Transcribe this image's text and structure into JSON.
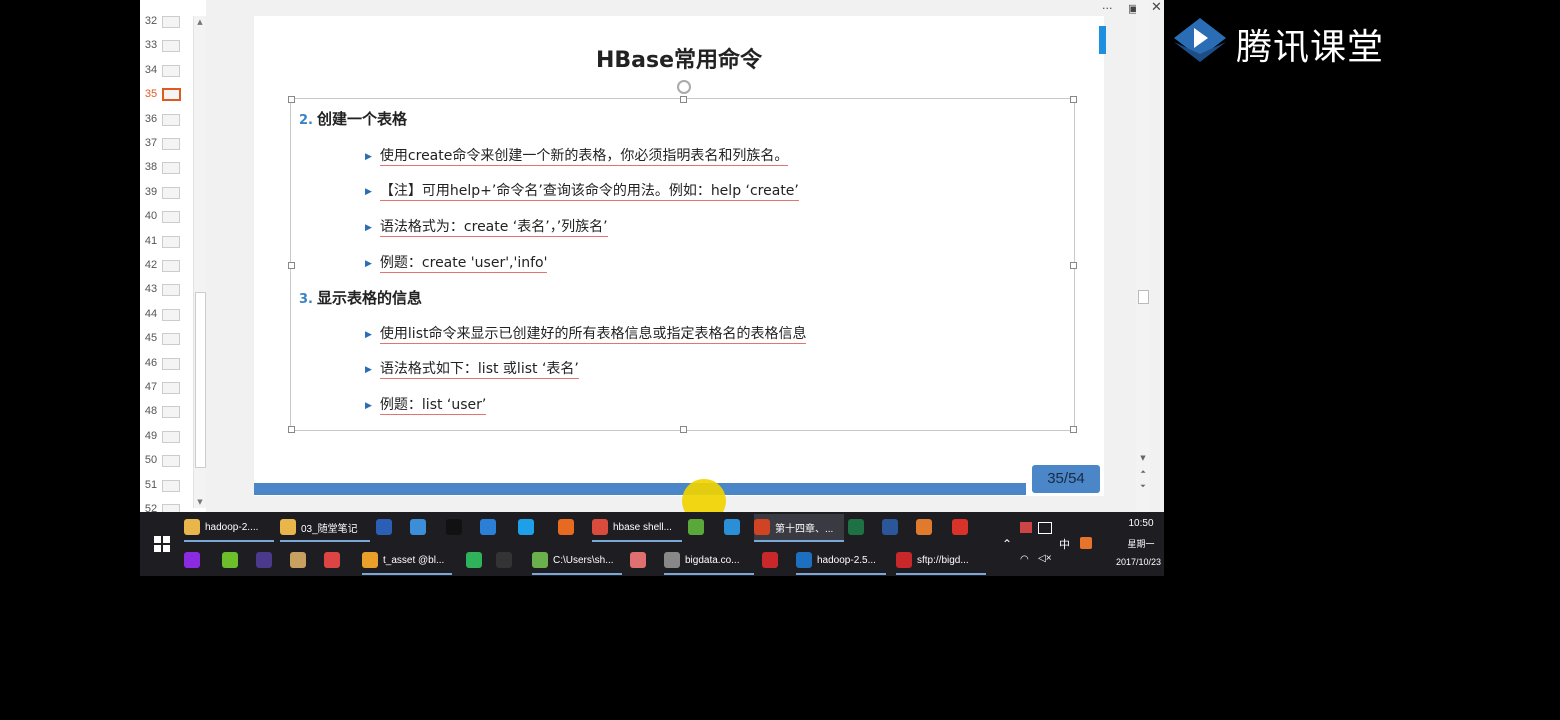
{
  "thumbnails": {
    "items": [
      {
        "number": "32"
      },
      {
        "number": "33"
      },
      {
        "number": "34"
      },
      {
        "number": "35"
      },
      {
        "number": "36"
      },
      {
        "number": "37"
      },
      {
        "number": "38"
      },
      {
        "number": "39"
      },
      {
        "number": "40"
      },
      {
        "number": "41"
      },
      {
        "number": "42"
      },
      {
        "number": "43"
      },
      {
        "number": "44"
      },
      {
        "number": "45"
      },
      {
        "number": "46"
      },
      {
        "number": "47"
      },
      {
        "number": "48"
      },
      {
        "number": "49"
      },
      {
        "number": "50"
      },
      {
        "number": "51"
      },
      {
        "number": "52"
      }
    ],
    "active": "35"
  },
  "slide": {
    "title": "HBase常用命令",
    "section1": {
      "number": "2.",
      "heading": "创建一个表格"
    },
    "section1_bullets": [
      "使用create命令来创建一个新的表格，你必须指明表名和列族名。",
      "【注】可用help+’命令名’查询该命令的用法。例如：help ‘create’",
      "语法格式为：create ‘表名’，’列族名’",
      "例题：create 'user','info'"
    ],
    "section2": {
      "number": "3.",
      "heading": "显示表格的信息"
    },
    "section2_bullets": [
      "使用list命令来显示已创建好的所有表格信息或指定表格名的表格信息",
      "语法格式如下：list 或list ‘表名’",
      "例题：list ‘user’"
    ],
    "page_indicator": "35/54",
    "progress": 0.648,
    "accent_color": "#4a86c8"
  },
  "taskbar": {
    "row1": [
      {
        "label": "hadoop-2....",
        "icon": "folder-icon",
        "color": "#e8b64a"
      },
      {
        "label": "03_随堂笔记",
        "icon": "folder-icon",
        "color": "#e8b64a"
      },
      {
        "label": "",
        "icon": "g-app-icon",
        "color": "#2b5fb5"
      },
      {
        "label": "",
        "icon": "network-icon",
        "color": "#3c8ed8"
      },
      {
        "label": "",
        "icon": "qq-icon",
        "color": "#111"
      },
      {
        "label": "",
        "icon": "k-app-icon",
        "color": "#2c7fd6"
      },
      {
        "label": "",
        "icon": "ie-icon",
        "color": "#1ea0e8"
      },
      {
        "label": "",
        "icon": "firefox-icon",
        "color": "#e66a1f"
      },
      {
        "label": "hbase shell...",
        "icon": "chrome-icon",
        "color": "#d94b3c"
      },
      {
        "label": "",
        "icon": "green-app-icon",
        "color": "#5aa83a"
      },
      {
        "label": "",
        "icon": "bird-app-icon",
        "color": "#2b8fd8"
      },
      {
        "label": "第十四章、...",
        "icon": "powerpoint-icon",
        "color": "#d04423"
      },
      {
        "label": "",
        "icon": "excel-icon",
        "color": "#1e7145"
      },
      {
        "label": "",
        "icon": "word-icon",
        "color": "#2b579a"
      },
      {
        "label": "",
        "icon": "matlab-icon",
        "color": "#e07a2c"
      },
      {
        "label": "",
        "icon": "xmind-icon",
        "color": "#d8322a"
      }
    ],
    "row2": [
      {
        "label": "",
        "icon": "axure-icon",
        "color": "#8a2be2"
      },
      {
        "label": "",
        "icon": "green-circle-icon",
        "color": "#6cbf2a"
      },
      {
        "label": "",
        "icon": "eclipse-icon",
        "color": "#4b3a8c"
      },
      {
        "label": "",
        "icon": "cup-icon",
        "color": "#c8a060"
      },
      {
        "label": "",
        "icon": "diagram-icon",
        "color": "#d44"
      },
      {
        "label": "t_asset @bl...",
        "icon": "navicat-icon",
        "color": "#e8a02a"
      },
      {
        "label": "",
        "icon": "pycharm-icon",
        "color": "#2fb35a"
      },
      {
        "label": "",
        "icon": "jetbrains-icon",
        "color": "#333"
      },
      {
        "label": "C:\\Users\\sh...",
        "icon": "notepad-icon",
        "color": "#6ab04c"
      },
      {
        "label": "",
        "icon": "eraser-icon",
        "color": "#e07070"
      },
      {
        "label": "bigdata.co...",
        "icon": "server-icon",
        "color": "#888"
      },
      {
        "label": "",
        "icon": "filezilla-icon",
        "color": "#c8282a"
      },
      {
        "label": "hadoop-2.5...",
        "icon": "virtualbox-icon",
        "color": "#1d6fc0"
      },
      {
        "label": "sftp://bigd...",
        "icon": "filezilla-icon",
        "color": "#c8282a"
      }
    ],
    "tray": {
      "ime": "中",
      "time": "10:50",
      "weekday": "星期一",
      "date": "2017/10/23"
    }
  },
  "watermark": {
    "text": "腾讯课堂"
  }
}
